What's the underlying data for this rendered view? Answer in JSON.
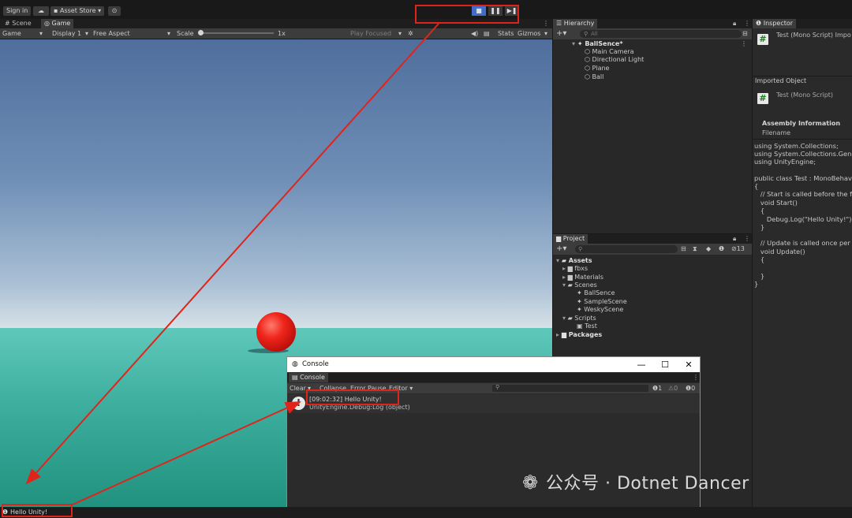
{
  "toolbar": {
    "sign_in": "Sign in",
    "cloud_icon": "cloud-icon",
    "asset_store": "Asset Store ▾",
    "play_controls": [
      "■",
      "❚❚",
      "▶❚"
    ]
  },
  "game_panel": {
    "tabs": [
      "Scene",
      "Game"
    ],
    "mode": "Game",
    "display": "Display 1",
    "aspect": "Free Aspect",
    "scale_label": "Scale",
    "scale_value": "1x",
    "play_focused": "Play Focused",
    "stats": "Stats",
    "gizmos": "Gizmos"
  },
  "hierarchy": {
    "title": "Hierarchy",
    "search_placeholder": "All",
    "scene": "BallSence*",
    "items": [
      "Main Camera",
      "Directional Light",
      "Plane",
      "Ball"
    ]
  },
  "project": {
    "title": "Project",
    "hidden_count": "13",
    "tree": {
      "assets": "Assets",
      "fbxs": "fbxs",
      "materials": "Materials",
      "scenes": "Scenes",
      "scene_items": [
        "BallSence",
        "SampleScene",
        "WeskyScene"
      ],
      "scripts": "Scripts",
      "script_items": [
        "Test"
      ],
      "packages": "Packages"
    }
  },
  "inspector": {
    "title": "Inspector",
    "header": "Test (Mono Script) Impo",
    "imported_object": "Imported Object",
    "object_name": "Test (Mono Script)",
    "assembly_info": "Assembly Information",
    "filename_label": "Filename",
    "code_lines": [
      "using System.Collections;",
      "using System.Collections.Gene",
      "using UnityEngine;",
      "",
      "public class Test : MonoBehavi",
      "{",
      "   // Start is called before the fi",
      "   void Start()",
      "   {",
      "      Debug.Log(\"Hello Unity!\");",
      "   }",
      "",
      "   // Update is called once per",
      "   void Update()",
      "   {",
      "",
      "   }",
      "}"
    ]
  },
  "console_window": {
    "window_title": "Console",
    "tab": "Console",
    "clear": "Clear",
    "collapse": "Collapse",
    "error_pause": "Error Pause",
    "editor": "Editor ▾",
    "count_log": "1",
    "count_warn": "0",
    "count_error": "0",
    "log_message": "[09:02:32] Hello Unity!",
    "log_trace": "UnityEngine.Debug:Log (object)",
    "win_minimize": "—",
    "win_maximize": "☐",
    "win_close": "✕"
  },
  "status_bar": {
    "message": "Hello Unity!"
  },
  "watermark": "公众号 · Dotnet Dancer",
  "colors": {
    "annotation_red": "#e0241b",
    "play_active": "#3f6dc9",
    "ball_red": "#f0261b",
    "ground_teal": "#3fb0a0"
  }
}
